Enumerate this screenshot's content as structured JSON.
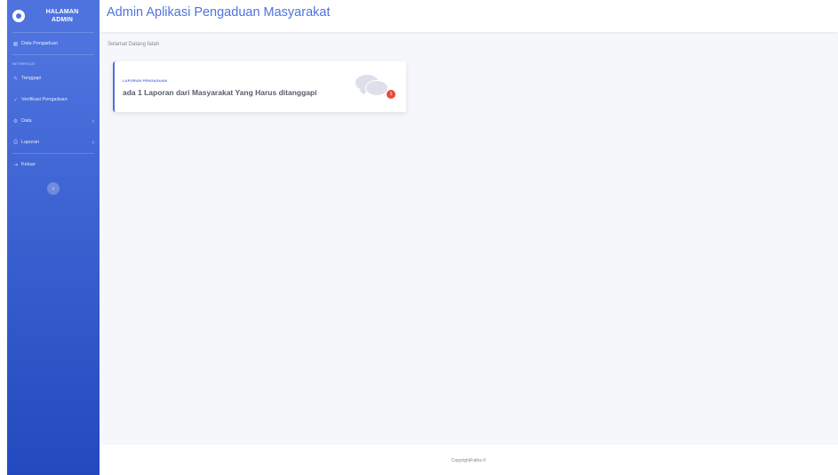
{
  "overlap": {
    "text": "nggapi"
  },
  "sidebar": {
    "brand_line1": "HALAMAN",
    "brand_line2": "ADMIN",
    "items": [
      {
        "label": "Data Pengaduan",
        "icon": "table-icon"
      },
      {
        "label": "Tanggapi",
        "icon": "edit-icon"
      },
      {
        "label": "Verifikasi Pengaduan",
        "icon": "check-icon"
      },
      {
        "label": "Data",
        "icon": "gear-icon"
      },
      {
        "label": "Laporan",
        "icon": "print-icon"
      },
      {
        "label": "Keluar",
        "icon": "logout-icon"
      }
    ],
    "section_heading": "INTERFACE",
    "chevron": "›",
    "toggle": "‹"
  },
  "header": {
    "title": "Admin Aplikasi Pengaduan Masyarakat"
  },
  "main": {
    "welcome": "Selamat Datang fatah",
    "card": {
      "label": "LAPORAN PENGADUAN",
      "text": "ada 1 Laporan dari Masyarakat Yang Harus ditanggapi",
      "badge": "1",
      "icon": "comments-icon"
    }
  },
  "footer": {
    "text": "CopyrightFatha ©"
  },
  "colors": {
    "primary": "#4e73df",
    "badge": "#e74a3b",
    "background": "#f6f7fb"
  }
}
